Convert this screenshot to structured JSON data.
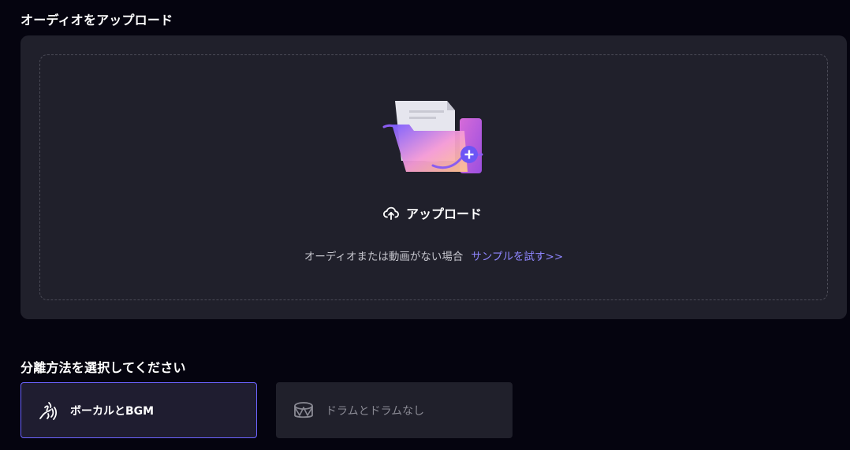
{
  "upload_section": {
    "title": "オーディオをアップロード",
    "upload_label": "アップロード",
    "hint": "オーディオまたは動画がない場合",
    "sample_link": "サンプルを試す>>"
  },
  "mode_section": {
    "title": "分離方法を選択してください",
    "options": [
      {
        "label": "ボーカルとBGM",
        "icon": "vocal-wave-icon",
        "selected": true
      },
      {
        "label": "ドラムとドラムなし",
        "icon": "drum-icon",
        "selected": false
      }
    ]
  },
  "colors": {
    "background": "#05040f",
    "card": "#20202b",
    "accent": "#6c63ff",
    "link": "#8f86ff"
  }
}
